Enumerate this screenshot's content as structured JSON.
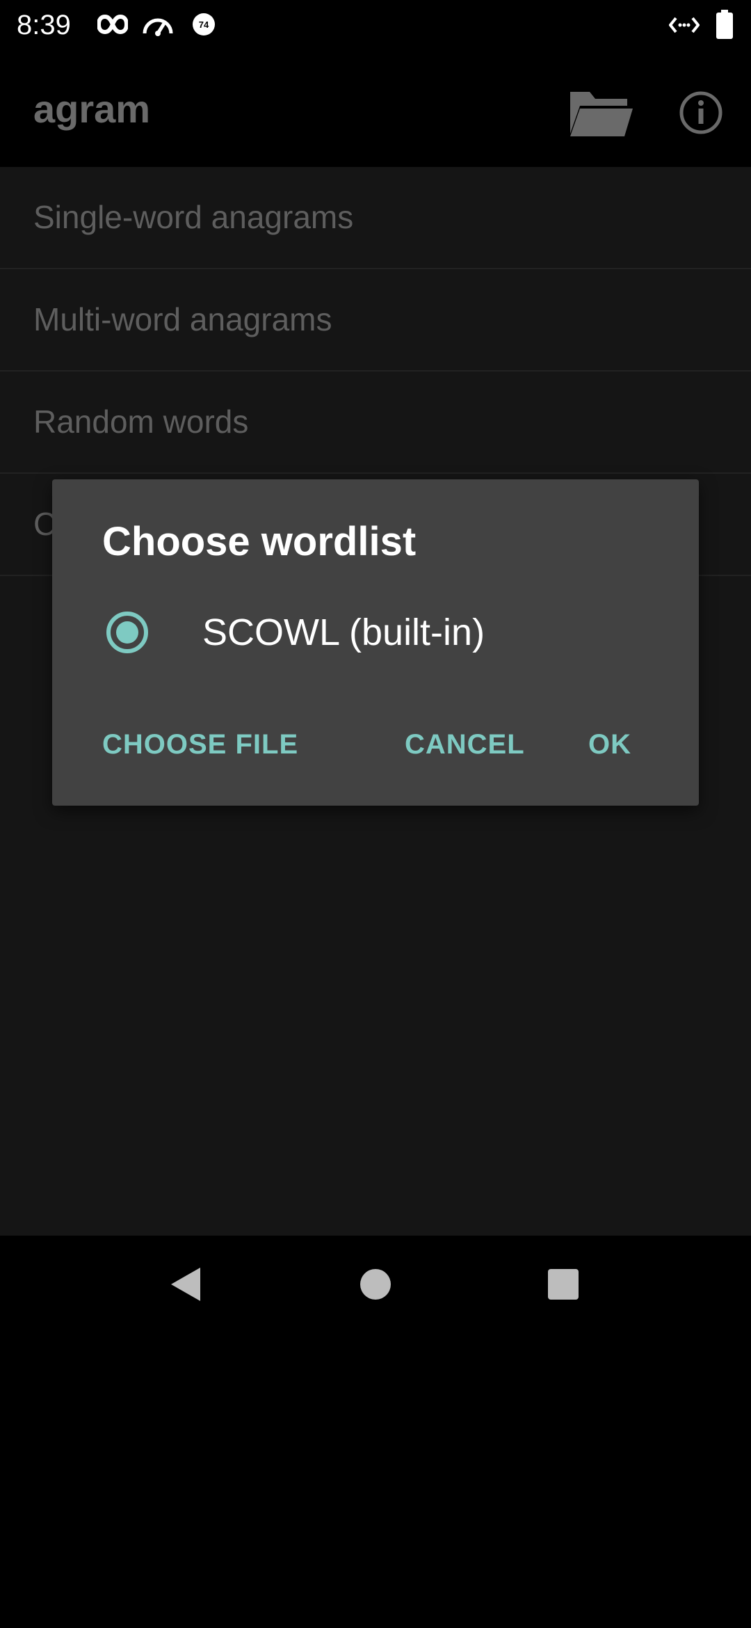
{
  "status_bar": {
    "time": "8:39",
    "notification_icons": [
      "infinity-icon",
      "speedometer-icon",
      "badge-74-icon"
    ],
    "badge_number": "74",
    "right_icons": [
      "code-arrows-icon",
      "battery-icon"
    ]
  },
  "app_bar": {
    "title": "agram",
    "actions": [
      "folder-icon",
      "info-icon"
    ]
  },
  "menu": {
    "items": [
      {
        "label": "Single-word anagrams"
      },
      {
        "label": "Multi-word anagrams"
      },
      {
        "label": "Random words"
      },
      {
        "label": "C"
      }
    ]
  },
  "dialog": {
    "title": "Choose wordlist",
    "option": {
      "label": "SCOWL (built-in)",
      "selected": true
    },
    "buttons": {
      "choose_file": "CHOOSE FILE",
      "cancel": "CANCEL",
      "ok": "OK"
    }
  },
  "nav_bar": {
    "icons": [
      "back-triangle-icon",
      "home-circle-icon",
      "recents-square-icon"
    ]
  },
  "colors": {
    "accent": "#7ecac2",
    "dialog_bg": "#424242",
    "content_bg": "#151515"
  }
}
